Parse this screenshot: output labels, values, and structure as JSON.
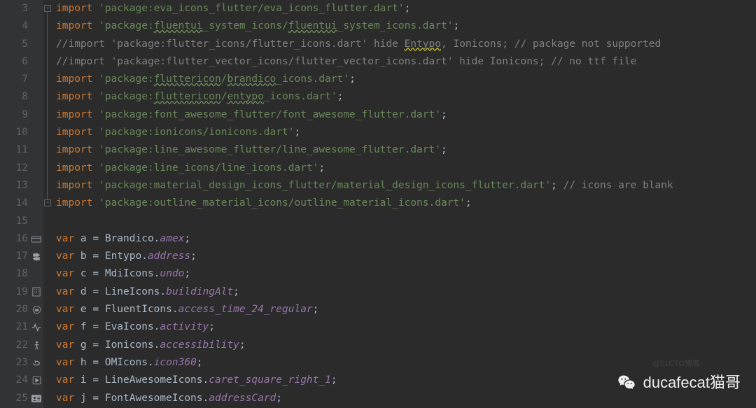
{
  "lines": [
    {
      "num": 3,
      "icon": null,
      "fold": "top",
      "tokens": [
        {
          "t": "kw",
          "v": "import "
        },
        {
          "t": "str",
          "v": "'package:eva_icons_flutter/eva_icons_flutter.dart'"
        },
        {
          "t": "plain",
          "v": ";"
        }
      ]
    },
    {
      "num": 4,
      "icon": null,
      "fold": "line",
      "tokens": [
        {
          "t": "kw",
          "v": "import "
        },
        {
          "t": "str",
          "v": "'package:"
        },
        {
          "t": "str wavy",
          "v": "fluentui"
        },
        {
          "t": "str",
          "v": "_system_icons/"
        },
        {
          "t": "str wavy",
          "v": "fluentui"
        },
        {
          "t": "str",
          "v": "_system_icons.dart'"
        },
        {
          "t": "plain",
          "v": ";"
        }
      ]
    },
    {
      "num": 5,
      "icon": null,
      "fold": "line",
      "tokens": [
        {
          "t": "cmt",
          "v": "//import 'package:flutter_icons/flutter_icons.dart' hide "
        },
        {
          "t": "cmt wavy-warn",
          "v": "Entypo"
        },
        {
          "t": "cmt",
          "v": ", Ionicons; // package not supported"
        }
      ]
    },
    {
      "num": 6,
      "icon": null,
      "fold": "line",
      "tokens": [
        {
          "t": "cmt",
          "v": "//import 'package:flutter_vector_icons/flutter_vector_icons.dart' hide Ionicons; // no ttf file"
        }
      ]
    },
    {
      "num": 7,
      "icon": null,
      "fold": "line",
      "tokens": [
        {
          "t": "kw",
          "v": "import "
        },
        {
          "t": "str",
          "v": "'package:"
        },
        {
          "t": "str wavy",
          "v": "fluttericon"
        },
        {
          "t": "str",
          "v": "/"
        },
        {
          "t": "str wavy",
          "v": "brandico"
        },
        {
          "t": "str",
          "v": "_icons.dart'"
        },
        {
          "t": "plain",
          "v": ";"
        }
      ]
    },
    {
      "num": 8,
      "icon": null,
      "fold": "line",
      "tokens": [
        {
          "t": "kw",
          "v": "import "
        },
        {
          "t": "str",
          "v": "'package:"
        },
        {
          "t": "str wavy",
          "v": "fluttericon"
        },
        {
          "t": "str",
          "v": "/"
        },
        {
          "t": "str wavy",
          "v": "entypo"
        },
        {
          "t": "str",
          "v": "_icons.dart'"
        },
        {
          "t": "plain",
          "v": ";"
        }
      ]
    },
    {
      "num": 9,
      "icon": null,
      "fold": "line",
      "tokens": [
        {
          "t": "kw",
          "v": "import "
        },
        {
          "t": "str",
          "v": "'package:font_awesome_flutter/font_awesome_flutter.dart'"
        },
        {
          "t": "plain",
          "v": ";"
        }
      ]
    },
    {
      "num": 10,
      "icon": null,
      "fold": "line",
      "tokens": [
        {
          "t": "kw",
          "v": "import "
        },
        {
          "t": "str",
          "v": "'package:ionicons/ionicons.dart'"
        },
        {
          "t": "plain",
          "v": ";"
        }
      ]
    },
    {
      "num": 11,
      "icon": null,
      "fold": "line",
      "tokens": [
        {
          "t": "kw",
          "v": "import "
        },
        {
          "t": "str",
          "v": "'package:line_awesome_flutter/line_awesome_flutter.dart'"
        },
        {
          "t": "plain",
          "v": ";"
        }
      ]
    },
    {
      "num": 12,
      "icon": null,
      "fold": "line",
      "tokens": [
        {
          "t": "kw",
          "v": "import "
        },
        {
          "t": "str",
          "v": "'package:line_icons/line_icons.dart'"
        },
        {
          "t": "plain",
          "v": ";"
        }
      ]
    },
    {
      "num": 13,
      "icon": null,
      "fold": "line",
      "tokens": [
        {
          "t": "kw",
          "v": "import "
        },
        {
          "t": "str",
          "v": "'package:material_design_icons_flutter/material_design_icons_flutter.dart'"
        },
        {
          "t": "plain",
          "v": "; "
        },
        {
          "t": "cmt",
          "v": "// icons are blank"
        }
      ]
    },
    {
      "num": 14,
      "icon": null,
      "fold": "bottom",
      "tokens": [
        {
          "t": "kw",
          "v": "import "
        },
        {
          "t": "str",
          "v": "'package:outline_material_icons/outline_material_icons.dart'"
        },
        {
          "t": "plain",
          "v": ";"
        }
      ]
    },
    {
      "num": 15,
      "icon": null,
      "fold": null,
      "tokens": [
        {
          "t": "plain",
          "v": ""
        }
      ]
    },
    {
      "num": 16,
      "icon": "card",
      "fold": null,
      "tokens": [
        {
          "t": "kw",
          "v": "var "
        },
        {
          "t": "plain",
          "v": "a = Brandico."
        },
        {
          "t": "prop",
          "v": "amex"
        },
        {
          "t": "plain",
          "v": ";"
        }
      ]
    },
    {
      "num": 17,
      "icon": "signpost",
      "fold": null,
      "tokens": [
        {
          "t": "kw",
          "v": "var "
        },
        {
          "t": "plain",
          "v": "b = Entypo."
        },
        {
          "t": "prop",
          "v": "address"
        },
        {
          "t": "plain",
          "v": ";"
        }
      ]
    },
    {
      "num": 18,
      "icon": null,
      "fold": null,
      "tokens": [
        {
          "t": "kw",
          "v": "var "
        },
        {
          "t": "plain",
          "v": "c = MdiIcons."
        },
        {
          "t": "prop",
          "v": "undo"
        },
        {
          "t": "plain",
          "v": ";"
        }
      ]
    },
    {
      "num": 19,
      "icon": "building",
      "fold": null,
      "tokens": [
        {
          "t": "kw",
          "v": "var "
        },
        {
          "t": "plain",
          "v": "d = LineIcons."
        },
        {
          "t": "prop",
          "v": "buildingAlt"
        },
        {
          "t": "plain",
          "v": ";"
        }
      ]
    },
    {
      "num": 20,
      "icon": "clock",
      "fold": null,
      "tokens": [
        {
          "t": "kw",
          "v": "var "
        },
        {
          "t": "plain",
          "v": "e = FluentIcons."
        },
        {
          "t": "prop",
          "v": "access_time_24_regular"
        },
        {
          "t": "plain",
          "v": ";"
        }
      ]
    },
    {
      "num": 21,
      "icon": "activity",
      "fold": null,
      "tokens": [
        {
          "t": "kw",
          "v": "var "
        },
        {
          "t": "plain",
          "v": "f = EvaIcons."
        },
        {
          "t": "prop",
          "v": "activity"
        },
        {
          "t": "plain",
          "v": ";"
        }
      ]
    },
    {
      "num": 22,
      "icon": "person",
      "fold": null,
      "tokens": [
        {
          "t": "kw",
          "v": "var "
        },
        {
          "t": "plain",
          "v": "g = Ionicons."
        },
        {
          "t": "prop",
          "v": "accessibility"
        },
        {
          "t": "plain",
          "v": ";"
        }
      ]
    },
    {
      "num": 23,
      "icon": "rotate",
      "fold": null,
      "tokens": [
        {
          "t": "kw",
          "v": "var "
        },
        {
          "t": "plain",
          "v": "h = OMIcons."
        },
        {
          "t": "prop",
          "v": "icon360"
        },
        {
          "t": "plain",
          "v": ";"
        }
      ]
    },
    {
      "num": 24,
      "icon": "caret",
      "fold": null,
      "tokens": [
        {
          "t": "kw",
          "v": "var "
        },
        {
          "t": "plain",
          "v": "i = LineAwesomeIcons."
        },
        {
          "t": "prop",
          "v": "caret_square_right_1"
        },
        {
          "t": "plain",
          "v": ";"
        }
      ]
    },
    {
      "num": 25,
      "icon": "idcard",
      "fold": null,
      "tokens": [
        {
          "t": "kw",
          "v": "var "
        },
        {
          "t": "plain",
          "v": "j = FontAwesomeIcons."
        },
        {
          "t": "prop",
          "v": "addressCard"
        },
        {
          "t": "plain",
          "v": ";"
        }
      ]
    }
  ],
  "watermark": {
    "text": "ducafecat猫哥"
  },
  "faint_mark": "@51CTO博客"
}
